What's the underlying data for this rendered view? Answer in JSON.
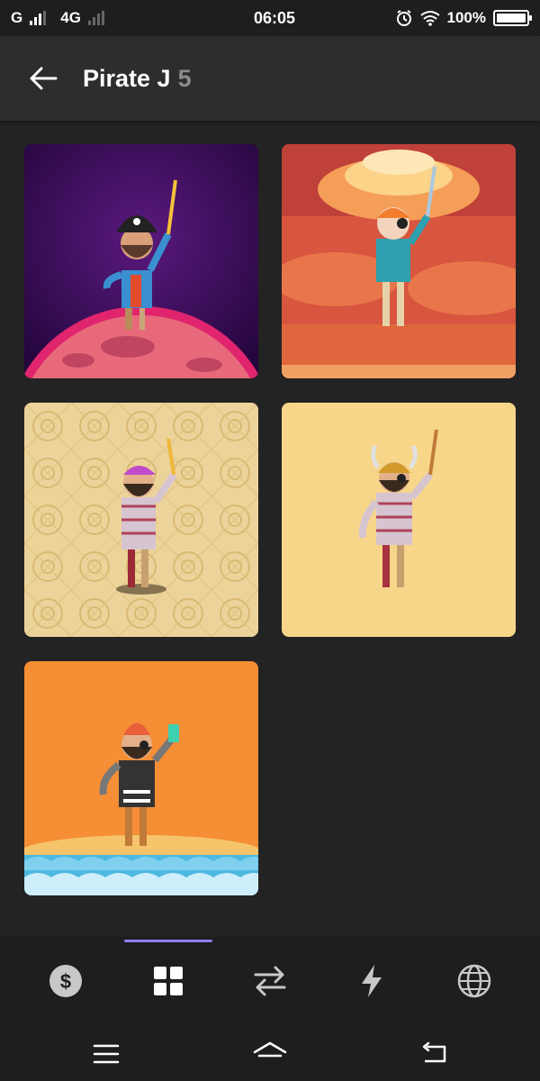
{
  "status_bar": {
    "carrier_left": "G",
    "network_type": "4G",
    "time": "06:05",
    "battery_percent": "100%",
    "battery_level": 1.0
  },
  "app_bar": {
    "title": "Pirate J",
    "count": "5"
  },
  "tiles": [
    {
      "name": "pirate-on-planet",
      "background": "#3a0e5e"
    },
    {
      "name": "pirate-explosion",
      "background": "#d8553f"
    },
    {
      "name": "pirate-pattern",
      "background": "#ecd39a"
    },
    {
      "name": "pirate-viking",
      "background": "#f7d68a"
    },
    {
      "name": "pirate-island",
      "background": "#f58e35"
    }
  ],
  "bottom_nav": {
    "items": [
      {
        "icon": "dollar-coin-icon"
      },
      {
        "icon": "grid-icon",
        "active": true
      },
      {
        "icon": "swap-arrows-icon"
      },
      {
        "icon": "lightning-icon"
      },
      {
        "icon": "globe-icon"
      }
    ],
    "accent": "#8e7ff0"
  },
  "system_nav": {
    "items": [
      {
        "icon": "menu-icon"
      },
      {
        "icon": "home-icon"
      },
      {
        "icon": "back-icon"
      }
    ]
  }
}
